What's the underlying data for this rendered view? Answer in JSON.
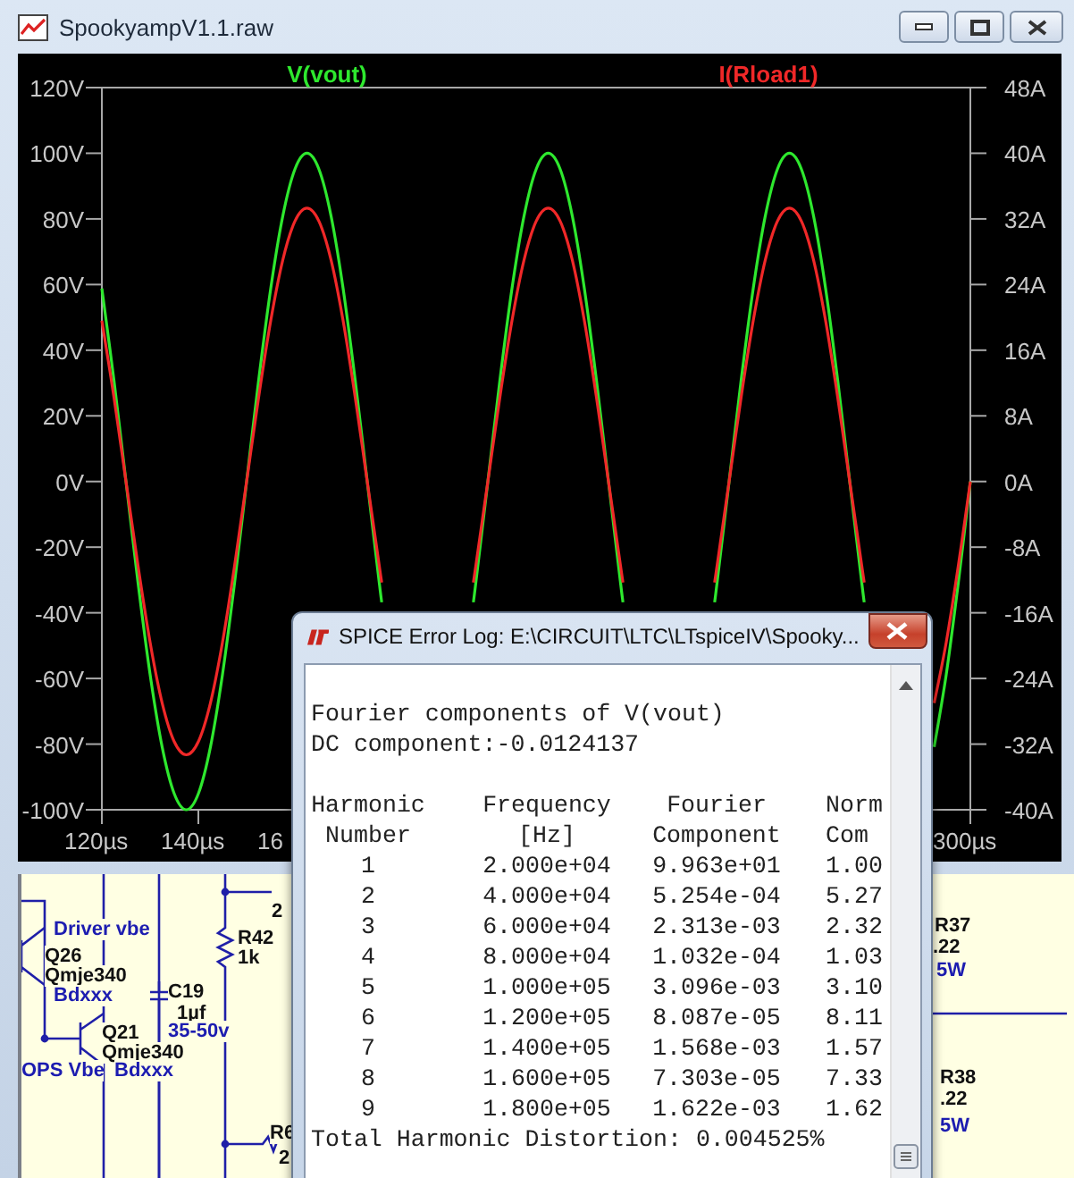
{
  "window": {
    "title": "SpookyampV1.1.raw"
  },
  "plot": {
    "cut_tick_label": "16",
    "chart_data": {
      "type": "line",
      "x": [
        120,
        122.5,
        125,
        127.5,
        130,
        132.5,
        135,
        137.5,
        140,
        142.5,
        145,
        147.5,
        150,
        152.5,
        155,
        157.5,
        160,
        162.5,
        165,
        167.5,
        170,
        172.5,
        175,
        177.5,
        178,
        197,
        197.5,
        200,
        202.5,
        205,
        207.5,
        210,
        212.5,
        215,
        217.5,
        220,
        222.5,
        225,
        227.5,
        228,
        247,
        247.5,
        250,
        252.5,
        255,
        257.5,
        260,
        262.5,
        265,
        267.5,
        270,
        272.5,
        275,
        277.5,
        278,
        292.5,
        295,
        297.5,
        300
      ],
      "series": [
        {
          "name": "V(vout)",
          "color": "#2ee82e",
          "values": [
            58.8,
            30.9,
            0,
            -30.9,
            -58.8,
            -80.9,
            -95.1,
            -100,
            -95.1,
            -80.9,
            -58.8,
            -30.9,
            0,
            30.9,
            58.8,
            80.9,
            95.1,
            100,
            95.1,
            80.9,
            58.8,
            30.9,
            0,
            -30.9,
            -36.8,
            -36.8,
            -30.9,
            0,
            30.9,
            58.8,
            80.9,
            95.1,
            100,
            95.1,
            80.9,
            58.8,
            30.9,
            0,
            -30.9,
            -36.8,
            -36.8,
            -30.9,
            0,
            30.9,
            58.8,
            80.9,
            95.1,
            100,
            95.1,
            80.9,
            58.8,
            30.9,
            0,
            -30.9,
            -36.8,
            -80.9,
            -58.8,
            -30.9,
            0
          ]
        },
        {
          "name": "I(Rload1)",
          "color": "#f02828",
          "axis": "y2",
          "values": [
            19.6,
            10.3,
            0,
            -10.3,
            -19.6,
            -27,
            -31.7,
            -33.3,
            -31.7,
            -27,
            -19.6,
            -10.3,
            0,
            10.3,
            19.6,
            27,
            31.7,
            33.3,
            31.7,
            27,
            19.6,
            10.3,
            0,
            -10.3,
            -12.3,
            -12.3,
            -10.3,
            0,
            10.3,
            19.6,
            27,
            31.7,
            33.3,
            31.7,
            27,
            19.6,
            10.3,
            0,
            -10.3,
            -12.3,
            -12.3,
            -10.3,
            0,
            10.3,
            19.6,
            27,
            31.7,
            33.3,
            31.7,
            27,
            19.6,
            10.3,
            0,
            -10.3,
            -12.3,
            -27,
            -19.6,
            -10.3,
            0
          ]
        }
      ],
      "xlim": [
        120,
        300
      ],
      "ylim": [
        -100,
        120
      ],
      "y2lim": [
        -40,
        48
      ],
      "xticks": [
        {
          "value": 120,
          "label": "120µs"
        },
        {
          "value": 140,
          "label": "140µs"
        },
        {
          "value": 300,
          "label": "300µs"
        }
      ],
      "yticks": [
        {
          "value": 120,
          "label": "120V"
        },
        {
          "value": 100,
          "label": "100V"
        },
        {
          "value": 80,
          "label": "80V"
        },
        {
          "value": 60,
          "label": "60V"
        },
        {
          "value": 40,
          "label": "40V"
        },
        {
          "value": 20,
          "label": "20V"
        },
        {
          "value": 0,
          "label": "0V"
        },
        {
          "value": -20,
          "label": "-20V"
        },
        {
          "value": -40,
          "label": "-40V"
        },
        {
          "value": -60,
          "label": "-60V"
        },
        {
          "value": -80,
          "label": "-80V"
        },
        {
          "value": -100,
          "label": "-100V"
        }
      ],
      "y2ticks": [
        {
          "value": 48,
          "label": "48A"
        },
        {
          "value": 40,
          "label": "40A"
        },
        {
          "value": 32,
          "label": "32A"
        },
        {
          "value": 24,
          "label": "24A"
        },
        {
          "value": 16,
          "label": "16A"
        },
        {
          "value": 8,
          "label": "8A"
        },
        {
          "value": 0,
          "label": "0A"
        },
        {
          "value": -8,
          "label": "-8A"
        },
        {
          "value": -16,
          "label": "-16A"
        },
        {
          "value": -24,
          "label": "-24A"
        },
        {
          "value": -32,
          "label": "-32A"
        },
        {
          "value": -40,
          "label": "-40A"
        }
      ]
    }
  },
  "schematic": {
    "labels": [
      {
        "text": "2",
        "kind": "name"
      },
      {
        "text": "Driver vbe",
        "kind": "attribute"
      },
      {
        "text": "Q26",
        "kind": "name"
      },
      {
        "text": "Qmje340",
        "kind": "name"
      },
      {
        "text": "Bdxxx",
        "kind": "attribute"
      },
      {
        "text": "R42",
        "kind": "name"
      },
      {
        "text": "1k",
        "kind": "name"
      },
      {
        "text": "C19",
        "kind": "name"
      },
      {
        "text": "1µf",
        "kind": "name"
      },
      {
        "text": "35-50v",
        "kind": "attribute"
      },
      {
        "text": "Q21",
        "kind": "name"
      },
      {
        "text": "Qmje340",
        "kind": "name"
      },
      {
        "text": "OPS Vbe",
        "kind": "attribute"
      },
      {
        "text": "Bdxxx",
        "kind": "attribute"
      },
      {
        "text": "R6",
        "kind": "name"
      },
      {
        "text": "2",
        "kind": "name"
      },
      {
        "text": "R37",
        "kind": "name"
      },
      {
        "text": ".22",
        "kind": "name"
      },
      {
        "text": "5W",
        "kind": "attribute"
      },
      {
        "text": "R38",
        "kind": "name"
      },
      {
        "text": ".22",
        "kind": "name"
      },
      {
        "text": "5W",
        "kind": "attribute"
      }
    ]
  },
  "error_log": {
    "title": "SPICE Error Log: E:\\CIRCUIT\\LTC\\LTspiceIV\\Spooky...",
    "lines": [
      "Fourier components of V(vout)",
      "DC component:-0.0124137"
    ],
    "columns": [
      {
        "line1": "Harmonic",
        "line2": "Number"
      },
      {
        "line1": "Frequency",
        "line2": "[Hz]"
      },
      {
        "line1": "Fourier",
        "line2": "Component"
      },
      {
        "line1": "Norm",
        "line2": "Com"
      }
    ],
    "rows": [
      [
        "1",
        "2.000e+04",
        "9.963e+01",
        "1.00"
      ],
      [
        "2",
        "4.000e+04",
        "5.254e-04",
        "5.27"
      ],
      [
        "3",
        "6.000e+04",
        "2.313e-03",
        "2.32"
      ],
      [
        "4",
        "8.000e+04",
        "1.032e-04",
        "1.03"
      ],
      [
        "5",
        "1.000e+05",
        "3.096e-03",
        "3.10"
      ],
      [
        "6",
        "1.200e+05",
        "8.087e-05",
        "8.11"
      ],
      [
        "7",
        "1.400e+05",
        "1.568e-03",
        "1.57"
      ],
      [
        "8",
        "1.600e+05",
        "7.303e-05",
        "7.33"
      ],
      [
        "9",
        "1.800e+05",
        "1.622e-03",
        "1.62"
      ]
    ],
    "summary": "Total Harmonic Distortion: 0.004525%"
  }
}
